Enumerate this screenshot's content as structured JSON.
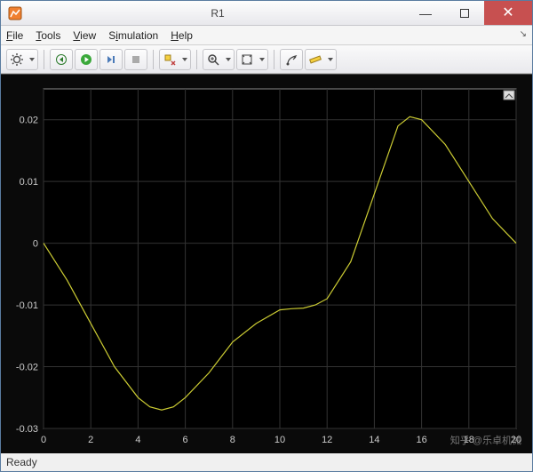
{
  "window": {
    "title": "R1"
  },
  "menubar": {
    "items": [
      "File",
      "Tools",
      "View",
      "Simulation",
      "Help"
    ]
  },
  "toolbar": {
    "icons": [
      "gear-icon",
      "dropdown-icon",
      "step-back-icon",
      "run-icon",
      "step-forward-icon",
      "stop-icon",
      "highlight-icon",
      "zoom-icon",
      "pan-icon",
      "cursor-icon",
      "ruler-icon"
    ]
  },
  "status": {
    "text": "Ready"
  },
  "watermark": "知乎 @乐卓机械",
  "chart_data": {
    "type": "line",
    "title": "",
    "xlabel": "",
    "ylabel": "",
    "xlim": [
      0,
      20
    ],
    "ylim": [
      -0.03,
      0.025
    ],
    "x_ticks": [
      0,
      2,
      4,
      6,
      8,
      10,
      12,
      14,
      16,
      18,
      20
    ],
    "y_ticks": [
      -0.03,
      -0.02,
      -0.01,
      0,
      0.01,
      0.02
    ],
    "grid": true,
    "series": [
      {
        "name": "R1",
        "color": "#cccc33",
        "x": [
          0,
          1,
          2,
          3,
          4,
          4.5,
          5,
          5.5,
          6,
          7,
          8,
          9,
          10,
          10.5,
          11,
          11.5,
          12,
          13,
          14,
          15,
          15.5,
          16,
          17,
          18,
          19,
          20
        ],
        "y": [
          0.0,
          -0.006,
          -0.013,
          -0.02,
          -0.025,
          -0.0265,
          -0.027,
          -0.0265,
          -0.025,
          -0.021,
          -0.016,
          -0.013,
          -0.0108,
          -0.0106,
          -0.0105,
          -0.01,
          -0.009,
          -0.003,
          0.008,
          0.019,
          0.0205,
          0.02,
          0.016,
          0.01,
          0.004,
          0.0
        ]
      }
    ]
  }
}
